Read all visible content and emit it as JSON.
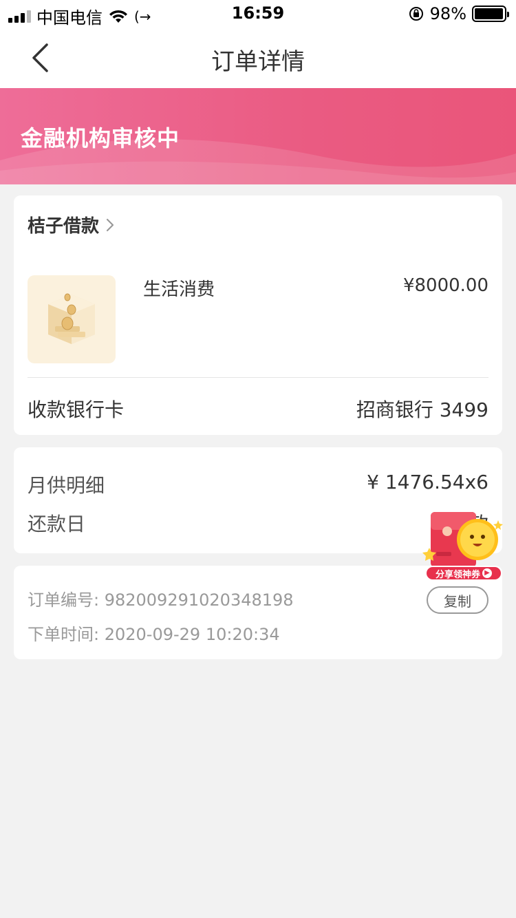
{
  "status_bar": {
    "carrier": "中国电信",
    "time": "16:59",
    "battery": "98%",
    "battery_level": 0.98
  },
  "nav": {
    "title": "订单详情"
  },
  "banner": {
    "status": "金融机构审核中"
  },
  "product_card": {
    "lender": "桔子借款",
    "product": "生活消费",
    "amount": "¥8000.00",
    "bank_label": "收款银行卡",
    "bank_value": "招商银行 3499"
  },
  "repay_card": {
    "monthly_label": "月供明细",
    "monthly_value": "¥ 1476.54x6",
    "due_label": "还款日",
    "due_value": "以放款"
  },
  "order_card": {
    "order_no": "订单编号: 982009291020348198",
    "order_time": "下单时间: 2020-09-29 10:20:34",
    "copy_label": "复制"
  },
  "promo": {
    "label": "分享领神券"
  },
  "colors": {
    "banner_start": "#ee6d98",
    "banner_end": "#ea557a",
    "promo_red": "#e8304c"
  }
}
